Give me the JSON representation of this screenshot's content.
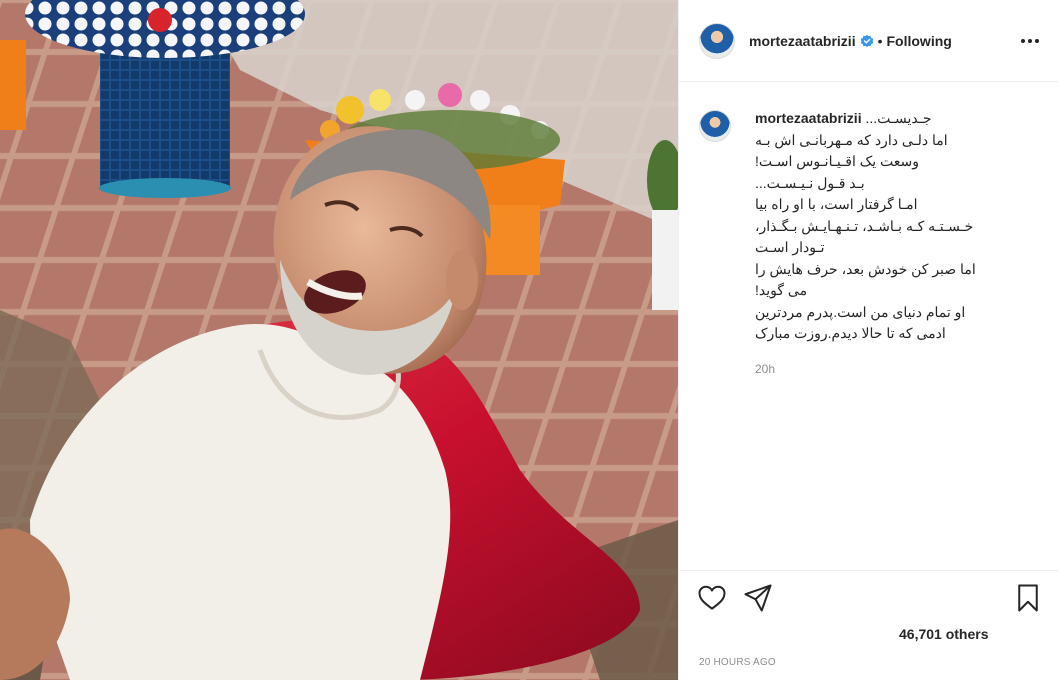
{
  "post": {
    "username": "mortezaatabrizii",
    "follow_status": "Following",
    "separator": "•",
    "caption": {
      "username": "mortezaatabrizii",
      "lines": [
        "جـدیسـت...",
        "اما دلـی دارد که مـهربانـی اش بـه",
        "وسعت یک اقـیـانـوس اسـت!",
        "بـد قـول نـیـسـت...",
        "امـا گرفتار است، با او راه بیا",
        "خـسـتـه کـه بـاشـد، تـنـهـایـش بـگـذار،",
        "تـودار اسـت",
        "اما صبر کن خودش بعد، حرف هایش را",
        "می گوید!",
        "او تمام دنیای من است.پدرم مردترین",
        "ادمی که تا حالا دیدم.روزت مبارک"
      ],
      "time_ago": "20h"
    },
    "likes_text": "46,701 others",
    "timestamp": "20 HOURS AGO"
  },
  "icons": {
    "verified": "verified-badge-icon",
    "more": "more-options-icon",
    "like": "heart-icon",
    "share": "paper-plane-icon",
    "save": "bookmark-icon"
  },
  "colors": {
    "verified_blue": "#3897f0",
    "text": "#262626",
    "muted": "#8e8e8e",
    "pillow_red": "#c8102e",
    "pot_orange": "#f07f1a"
  }
}
